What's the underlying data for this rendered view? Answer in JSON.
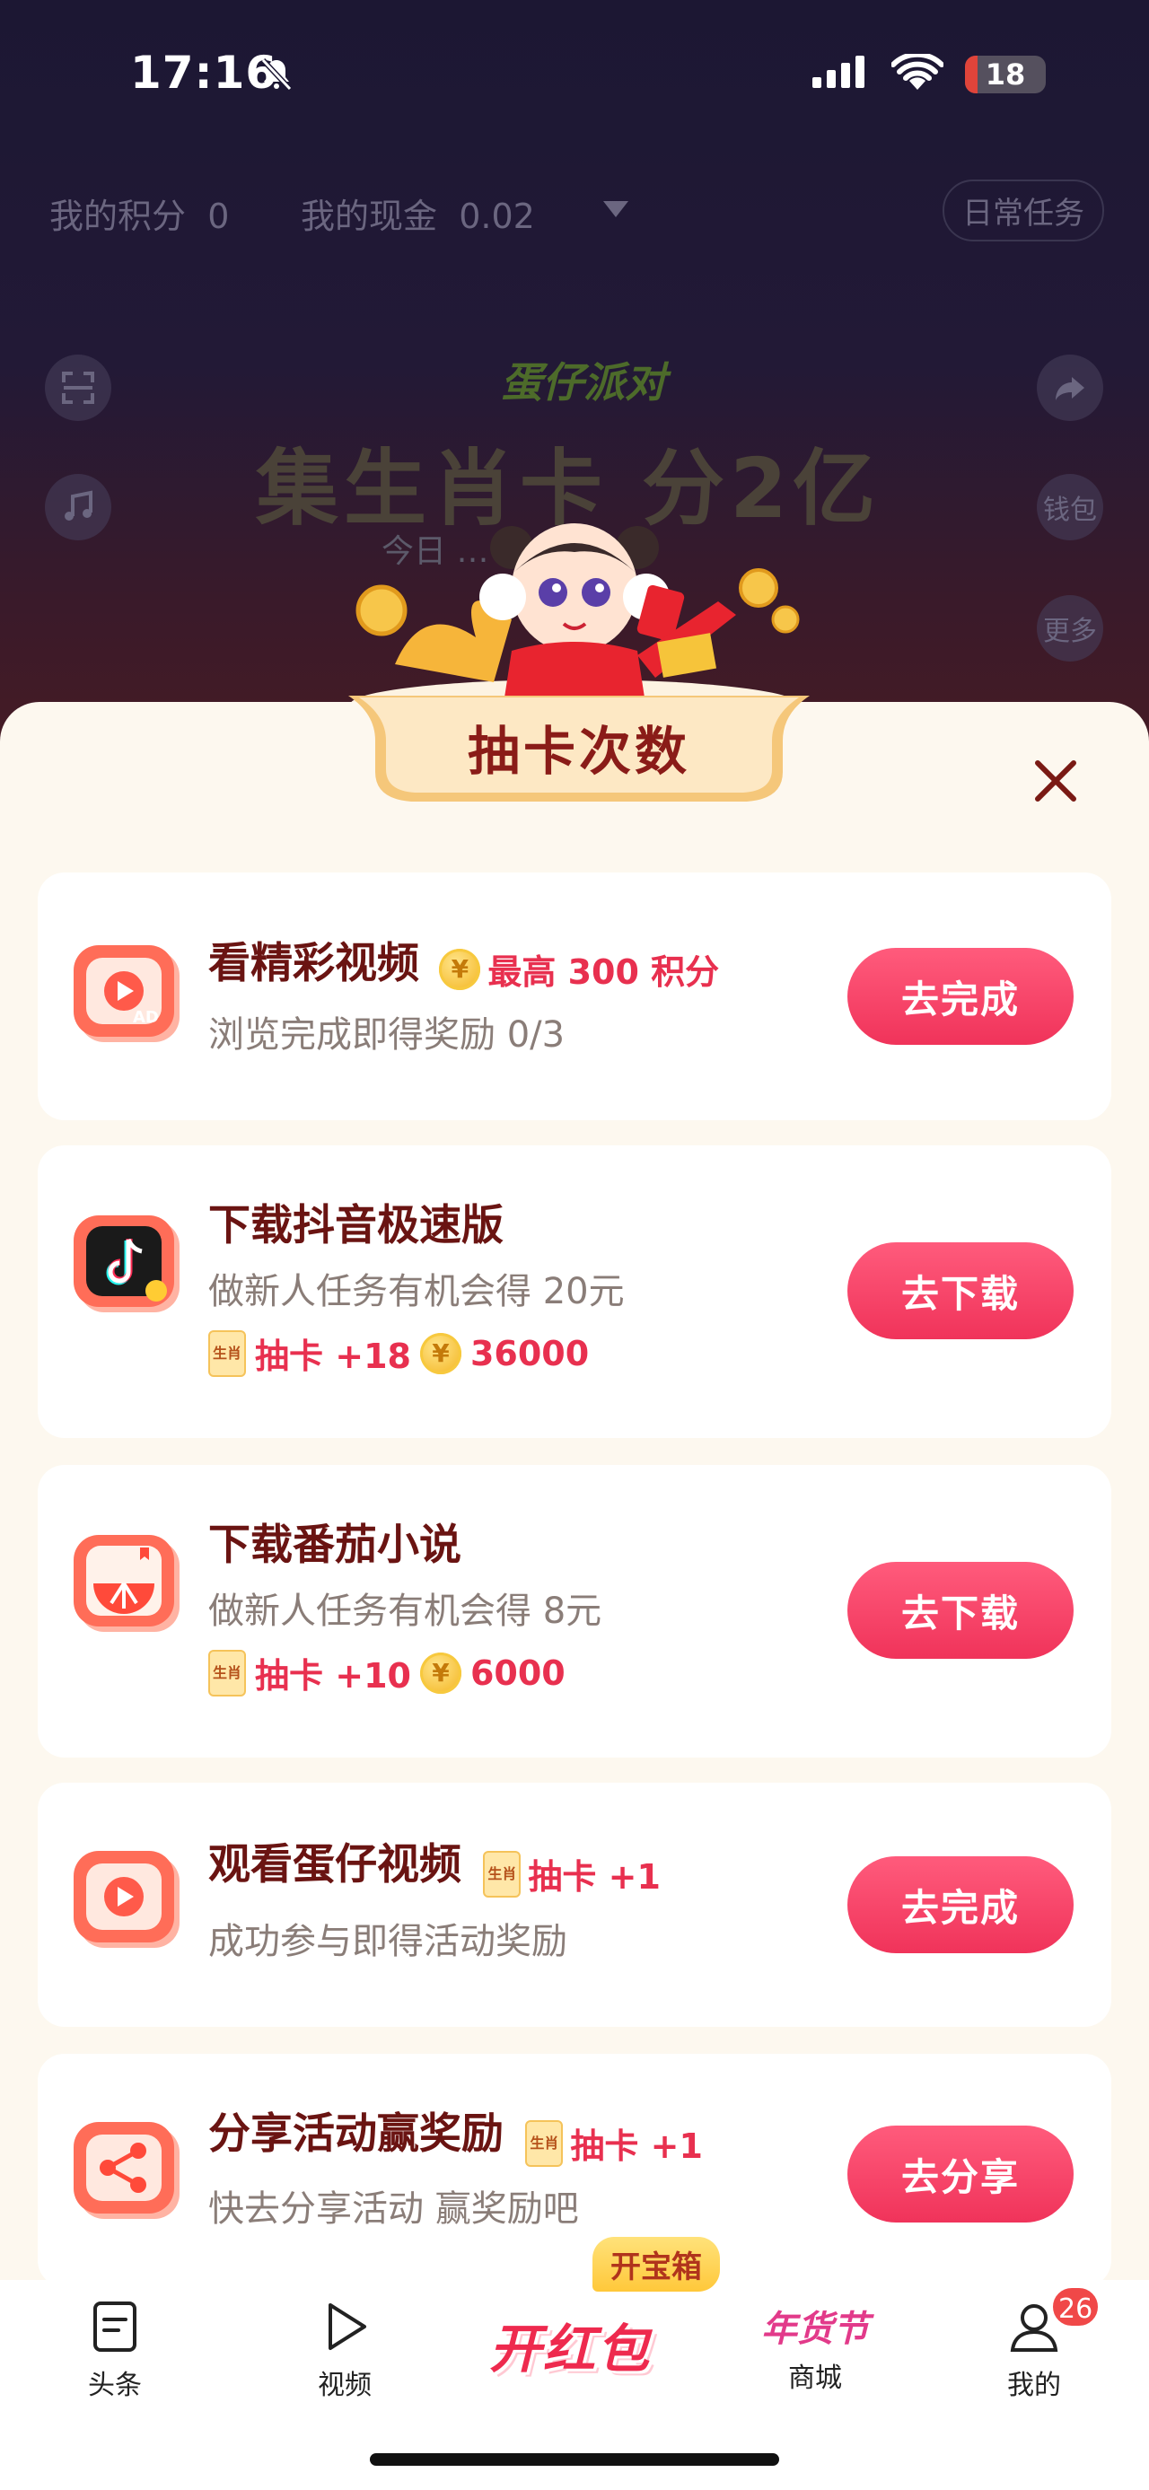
{
  "status_bar": {
    "time": "17:16",
    "battery": "18"
  },
  "background": {
    "points_label": "我的积分",
    "points_value": "0",
    "cash_label": "我的现金",
    "cash_value": "0.02",
    "daily_task": "日常任务",
    "logo_text": "蛋仔派对",
    "banner_title": "集生肖卡 分2亿",
    "banner_sub": "今日 … 周年",
    "side_wallet": "钱包",
    "side_more": "更多"
  },
  "modal": {
    "title": "抽卡次数",
    "tasks": [
      {
        "icon": "video-ad-icon",
        "title": "看精彩视频",
        "inline_reward": "最高 300 积分",
        "desc": "浏览完成即得奖励 0/3",
        "button": "去完成"
      },
      {
        "icon": "douyin-lite-icon",
        "title": "下载抖音极速版",
        "desc": "做新人任务有机会得 20元",
        "card_reward": "抽卡 +18",
        "coin_reward": "36000",
        "button": "去下载"
      },
      {
        "icon": "tomato-novel-icon",
        "title": "下载番茄小说",
        "desc": "做新人任务有机会得 8元",
        "card_reward": "抽卡 +10",
        "coin_reward": "6000",
        "button": "去下载"
      },
      {
        "icon": "play-video-icon",
        "title": "观看蛋仔视频",
        "inline_card": "抽卡 +1",
        "desc": "成功参与即得活动奖励",
        "button": "去完成"
      },
      {
        "icon": "share-icon",
        "title": "分享活动赢奖励",
        "inline_card": "抽卡 +1",
        "desc": "快去分享活动 赢奖励吧",
        "button": "去分享"
      }
    ],
    "card_tag_text": "生肖",
    "coin_symbol": "¥"
  },
  "tabbar": {
    "items": [
      {
        "label": "头条",
        "icon": "article-icon"
      },
      {
        "label": "视频",
        "icon": "play-icon"
      },
      {
        "label": "开红包",
        "icon": "red-packet-icon"
      },
      {
        "label": "商城",
        "icon": "festival-icon"
      },
      {
        "label": "我的",
        "icon": "profile-icon"
      }
    ],
    "treasure_label": "开宝箱",
    "festival_text": "年货节",
    "profile_badge": "26"
  },
  "colors": {
    "accent": "#f0335a",
    "title": "#6a1412",
    "sheet": "#fdf8ef"
  }
}
